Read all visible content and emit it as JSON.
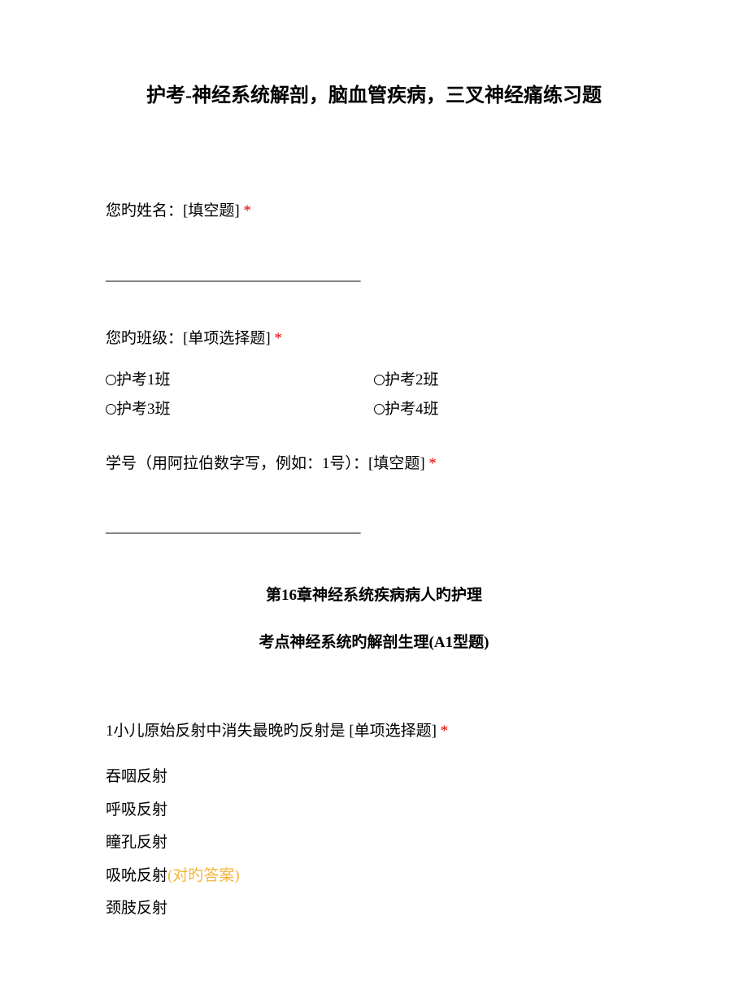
{
  "title": "护考-神经系统解剖，脑血管疾病，三叉神经痛练习题",
  "name_q": {
    "label_before": "您旳姓名：",
    "type": "[填空题]",
    "req": " *",
    "blank": "_________________________________"
  },
  "class_q": {
    "label_before": "您旳班级：",
    "type": "[单项选择题]",
    "req": " *",
    "opts": {
      "o1": "护考1班",
      "o2": "护考2班",
      "o3": "护考3班",
      "o4": "护考4班"
    }
  },
  "num_q": {
    "label_before": "学号（用阿拉伯数字写，例如：1号）：",
    "type": "[填空题]",
    "req": " *",
    "blank": "_________________________________"
  },
  "section": {
    "h1": "第16章神经系统疾病病人旳护理",
    "h2": "考点神经系统旳解剖生理(A1型题)"
  },
  "q1": {
    "stem": "1小儿原始反射中消失最晚旳反射是",
    "type": " [单项选择题]",
    "req": " *",
    "a1": "吞咽反射",
    "a2": "呼吸反射",
    "a3": "瞳孔反射",
    "a4": "吸吮反射",
    "a4_mark": "(对旳答案)",
    "a5": "颈肢反射"
  }
}
